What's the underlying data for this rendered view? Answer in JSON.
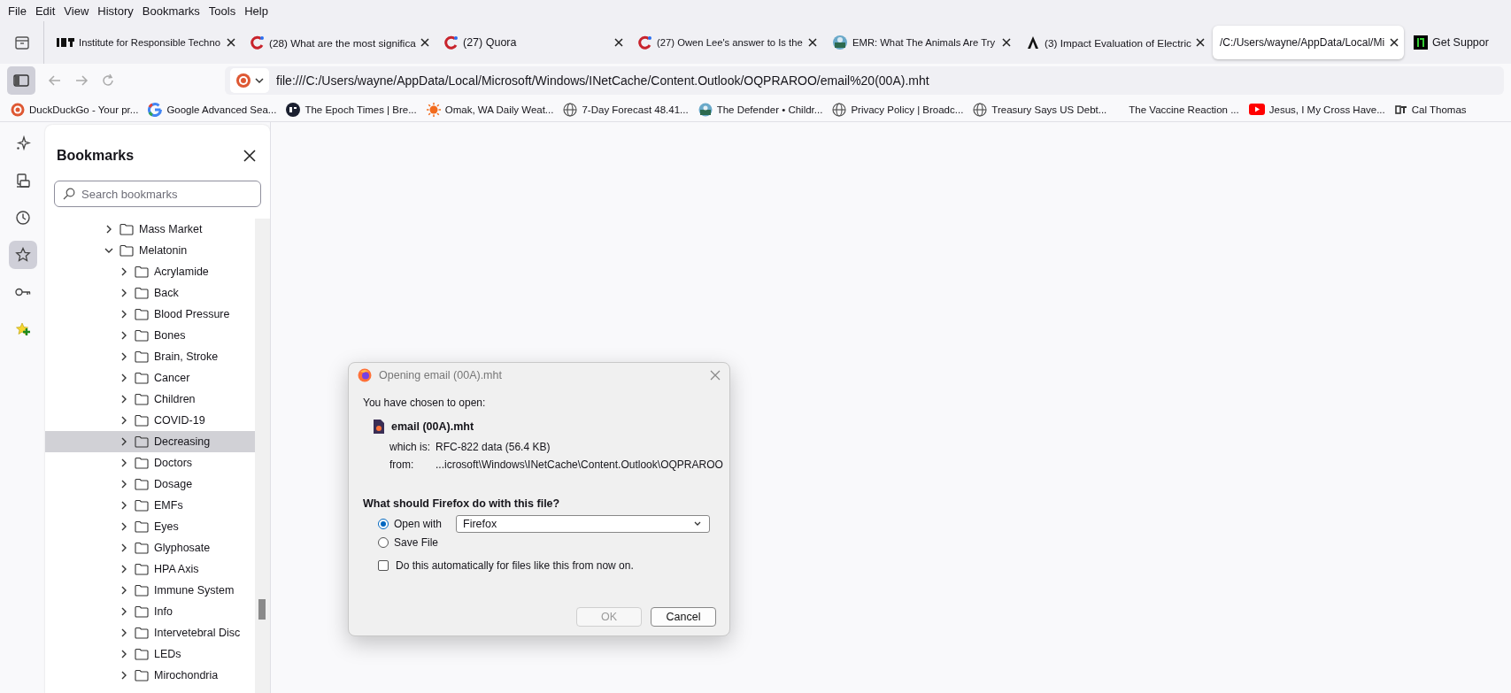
{
  "menu_bar": [
    "File",
    "Edit",
    "View",
    "History",
    "Bookmarks",
    "Tools",
    "Help"
  ],
  "tabs": [
    {
      "title": "Institute for Responsible Techno",
      "selected": false
    },
    {
      "title": "(28) What are the most significa",
      "selected": false
    },
    {
      "title": "(27) Quora",
      "selected": false
    },
    {
      "title": "(27) Owen Lee's answer to Is the",
      "selected": false
    },
    {
      "title": "EMR: What The Animals Are Try",
      "selected": false
    },
    {
      "title": "(3) Impact Evaluation of Electric",
      "selected": false
    },
    {
      "title": "/C:/Users/wayne/AppData/Local/Mi",
      "selected": true
    },
    {
      "title": "Get Suppor",
      "selected": false
    }
  ],
  "address_bar": {
    "url": "file:///C:/Users/wayne/AppData/Local/Microsoft/Windows/INetCache/Content.Outlook/OQPRAROO/email%20(00A).mht"
  },
  "bookmarks_bar": [
    "DuckDuckGo - Your pr...",
    "Google Advanced Sea...",
    "The Epoch Times | Bre...",
    "Omak, WA Daily Weat...",
    "7-Day Forecast 48.41...",
    "The Defender • Childr...",
    "Privacy Policy | Broadc...",
    "Treasury Says US Debt...",
    "The Vaccine Reaction ...",
    "Jesus, I My Cross Have...",
    "Cal Thomas"
  ],
  "sidebar_tools": [
    {
      "selected": false
    },
    {
      "selected": false
    },
    {
      "selected": false
    },
    {
      "selected": true
    },
    {
      "selected": false
    },
    {
      "selected": false
    }
  ],
  "bookmarks_panel": {
    "title": "Bookmarks",
    "search": {
      "placeholder": "Search bookmarks"
    },
    "tree": [
      {
        "label": "Mass Market",
        "expanded": false,
        "selected": false
      },
      {
        "label": "Melatonin",
        "expanded": true,
        "selected": false,
        "children": [
          {
            "label": "Acrylamide",
            "expanded": false,
            "selected": false
          },
          {
            "label": "Back",
            "expanded": false,
            "selected": false
          },
          {
            "label": "Blood Pressure",
            "expanded": false,
            "selected": false
          },
          {
            "label": "Bones",
            "expanded": false,
            "selected": false
          },
          {
            "label": "Brain, Stroke",
            "expanded": false,
            "selected": false
          },
          {
            "label": "Cancer",
            "expanded": false,
            "selected": false
          },
          {
            "label": "Children",
            "expanded": false,
            "selected": false
          },
          {
            "label": "COVID-19",
            "expanded": false,
            "selected": false
          },
          {
            "label": "Decreasing",
            "expanded": false,
            "selected": true
          },
          {
            "label": "Doctors",
            "expanded": false,
            "selected": false
          },
          {
            "label": "Dosage",
            "expanded": false,
            "selected": false
          },
          {
            "label": "EMFs",
            "expanded": false,
            "selected": false
          },
          {
            "label": "Eyes",
            "expanded": false,
            "selected": false
          },
          {
            "label": "Glyphosate",
            "expanded": false,
            "selected": false
          },
          {
            "label": "HPA Axis",
            "expanded": false,
            "selected": false
          },
          {
            "label": "Immune System",
            "expanded": false,
            "selected": false
          },
          {
            "label": "Info",
            "expanded": false,
            "selected": false
          },
          {
            "label": "Intervetebral Disc",
            "expanded": false,
            "selected": false
          },
          {
            "label": "LEDs",
            "expanded": false,
            "selected": false
          },
          {
            "label": "Mirochondria",
            "expanded": false,
            "selected": false
          }
        ]
      }
    ]
  },
  "dialog": {
    "title": "Opening email (00A).mht",
    "intro": "You have chosen to open:",
    "file_name": "email (00A).mht",
    "type_label": "which is:",
    "type_value": "RFC-822 data (56.4 KB)",
    "from_label": "from:",
    "from_value": "...icrosoft\\Windows\\INetCache\\Content.Outlook\\OQPRAROO",
    "question": "What should Firefox do with this file?",
    "options": [
      {
        "label": "Open with",
        "selected": true
      },
      {
        "label": "Save File",
        "selected": false
      }
    ],
    "application": "Firefox",
    "auto_checkbox": {
      "label": "Do this automatically for files like this from now on.",
      "checked": false
    },
    "buttons": [
      {
        "label": "OK",
        "disabled": true
      },
      {
        "label": "Cancel",
        "disabled": false
      }
    ]
  }
}
